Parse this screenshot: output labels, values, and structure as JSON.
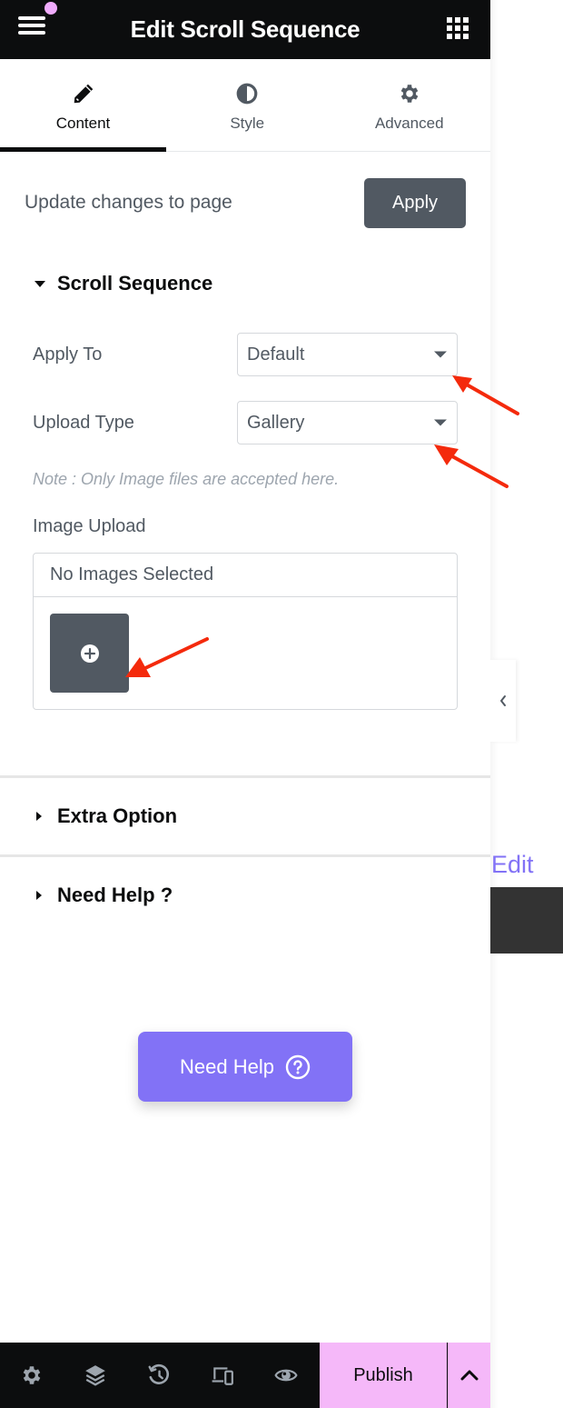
{
  "header": {
    "title": "Edit Scroll Sequence",
    "menu_icon": "hamburger-menu-icon",
    "apps_icon": "grid-apps-icon",
    "notification_color": "#f0abfc"
  },
  "tabs": [
    {
      "label": "Content",
      "icon": "pencil-icon",
      "active": true
    },
    {
      "label": "Style",
      "icon": "half-circle-contrast-icon",
      "active": false
    },
    {
      "label": "Advanced",
      "icon": "gear-icon",
      "active": false
    }
  ],
  "update": {
    "label": "Update changes to page",
    "button": "Apply"
  },
  "scroll_sequence": {
    "title": "Scroll Sequence",
    "expanded": true,
    "apply_to": {
      "label": "Apply To",
      "value": "Default"
    },
    "upload_type": {
      "label": "Upload Type",
      "value": "Gallery"
    },
    "note": "Note : Only Image files are accepted here.",
    "image_upload": {
      "label": "Image Upload",
      "status": "No Images Selected",
      "add_icon": "plus-circle-icon"
    }
  },
  "sections": [
    {
      "title": "Extra Option",
      "expanded": false
    },
    {
      "title": "Need Help ?",
      "expanded": false
    }
  ],
  "help_button": {
    "label": "Need Help",
    "icon": "question-circle-icon",
    "color": "#8272f6"
  },
  "preview": {
    "edit_link": "Edit",
    "edit_color": "#8272f6",
    "collapse_icon": "chevron-left-icon"
  },
  "footer": {
    "icons": [
      "settings-icon",
      "layers-icon",
      "history-icon",
      "responsive-mode-icon",
      "preview-eye-icon"
    ],
    "publish_label": "Publish",
    "publish_color": "#f5b8f9",
    "more_icon": "chevron-up-icon"
  },
  "colors": {
    "dark": "#0c0d0e",
    "secondary_text": "#515962",
    "muted_text": "#9da5ae",
    "annotation_arrow": "#f42a0c"
  }
}
